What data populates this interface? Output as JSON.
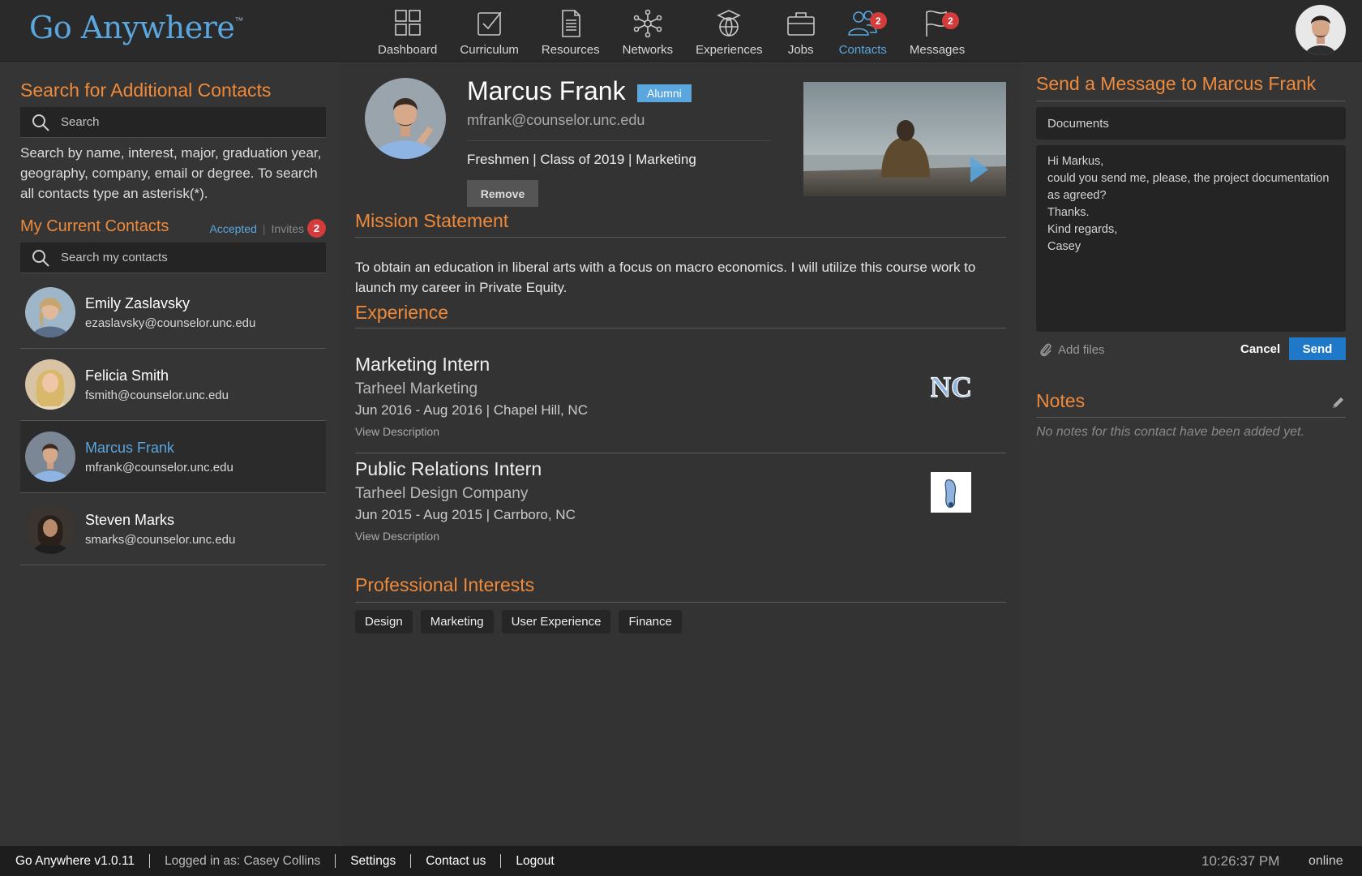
{
  "app": {
    "logo_text": "Go Anywhere",
    "logo_tm": "™"
  },
  "nav": [
    {
      "label": "Dashboard",
      "icon": "dashboard-icon",
      "badge": null,
      "active": false
    },
    {
      "label": "Curriculum",
      "icon": "checkbox-icon",
      "badge": null,
      "active": false
    },
    {
      "label": "Resources",
      "icon": "document-icon",
      "badge": null,
      "active": false
    },
    {
      "label": "Networks",
      "icon": "network-icon",
      "badge": null,
      "active": false
    },
    {
      "label": "Experiences",
      "icon": "globe-cap-icon",
      "badge": null,
      "active": false
    },
    {
      "label": "Jobs",
      "icon": "briefcase-icon",
      "badge": null,
      "active": false
    },
    {
      "label": "Contacts",
      "icon": "contacts-icon",
      "badge": "2",
      "active": true
    },
    {
      "label": "Messages",
      "icon": "flag-icon",
      "badge": "2",
      "active": false
    }
  ],
  "left": {
    "search_title": "Search for Additional Contacts",
    "search_placeholder": "Search",
    "help_text": "Search by name, interest, major, graduation year, geography, company, email or degree. To search all contacts type an asterisk(*).",
    "contacts_title": "My Current Contacts",
    "tab_accepted": "Accepted",
    "tab_separator": "|",
    "tab_invites": "Invites",
    "invites_badge": "2",
    "contacts_search_placeholder": "Search my contacts",
    "contacts": [
      {
        "name": "Emily Zaslavsky",
        "email": "ezaslavsky@counselor.unc.edu",
        "selected": false
      },
      {
        "name": "Felicia Smith",
        "email": "fsmith@counselor.unc.edu",
        "selected": false
      },
      {
        "name": "Marcus Frank",
        "email": "mfrank@counselor.unc.edu",
        "selected": true
      },
      {
        "name": "Steven Marks",
        "email": "smarks@counselor.unc.edu",
        "selected": false
      }
    ]
  },
  "profile": {
    "name": "Marcus Frank",
    "badge": "Alumni",
    "email": "mfrank@counselor.unc.edu",
    "meta": "Freshmen | Class of 2019 | Marketing",
    "remove_label": "Remove",
    "mission_title": "Mission Statement",
    "mission_text": "To obtain an education in liberal arts with a focus on macro economics. I will utilize this course work to launch my career in Private Equity.",
    "experience_title": "Experience",
    "experiences": [
      {
        "role": "Marketing Intern",
        "company": "Tarheel Marketing",
        "dates": "Jun 2016 - Aug 2016 | Chapel Hill, NC",
        "link": "View Description",
        "logo": "nc-logo-icon"
      },
      {
        "role": "Public Relations Intern",
        "company": "Tarheel Design Company",
        "dates": "Jun 2015 - Aug 2015 | Carrboro, NC",
        "link": "View Description",
        "logo": "footprint-logo-icon"
      }
    ],
    "interests_title": "Professional Interests",
    "interests": [
      "Design",
      "Marketing",
      "User Experience",
      "Finance"
    ]
  },
  "message": {
    "title": "Send a Message to Marcus Frank",
    "subject": "Documents",
    "body": "Hi Markus,\ncould you send me, please, the project documentation as agreed?\nThanks.\nKind regards,\nCasey",
    "add_files": "Add files",
    "cancel": "Cancel",
    "send": "Send"
  },
  "notes": {
    "title": "Notes",
    "empty": "No notes for this contact have been added yet."
  },
  "footer": {
    "version": "Go Anywhere v1.0.11",
    "logged_in": "Logged in as: Casey Collins",
    "settings": "Settings",
    "contact": "Contact us",
    "logout": "Logout",
    "time": "10:26:37 PM",
    "status": "online"
  },
  "colors": {
    "accent_orange": "#ef8a3b",
    "accent_blue": "#5aa6de",
    "badge_red": "#d43b3b",
    "send_blue": "#1f78c8"
  }
}
